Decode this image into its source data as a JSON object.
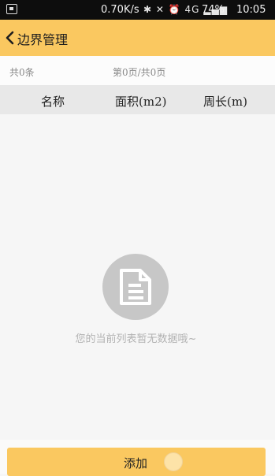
{
  "status_bar": {
    "speed": "0.70K/s",
    "icons_text": "✱ ✕ ⏰ 4G ▂▄▆",
    "battery": "74%",
    "time": "10:05"
  },
  "header": {
    "title": "边界管理"
  },
  "info_bar": {
    "total_count": "共0条",
    "pagination": "第0页/共0页"
  },
  "table": {
    "columns": [
      "名称",
      "面积(m2)",
      "周长(m)"
    ],
    "rows": []
  },
  "empty_state": {
    "message": "您的当前列表暂无数据哦~"
  },
  "actions": {
    "add_label": "添加"
  },
  "colors": {
    "accent": "#fac860",
    "header_bg": "#e8e8e8",
    "empty_icon": "#c7c7c7"
  }
}
